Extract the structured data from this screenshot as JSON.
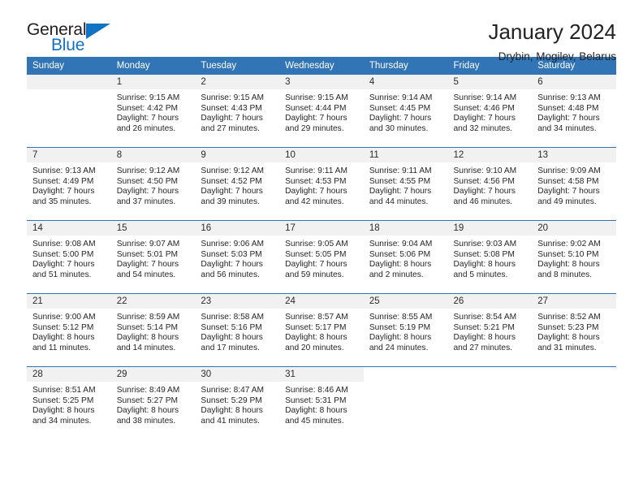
{
  "brand": {
    "name_top": "General",
    "name_bottom": "Blue",
    "accent_color": "#1273c4"
  },
  "header": {
    "title": "January 2024",
    "subtitle": "Drybin, Mogilev, Belarus"
  },
  "theme": {
    "header_blue": "#3175b7",
    "daynum_gray": "#f1f1f1",
    "text": "#262626"
  },
  "calendar": {
    "weekday_headers": [
      "Sunday",
      "Monday",
      "Tuesday",
      "Wednesday",
      "Thursday",
      "Friday",
      "Saturday"
    ],
    "weeks": [
      [
        {
          "day": "",
          "sunrise": "",
          "sunset": "",
          "daylight_1": "",
          "daylight_2": "",
          "empty": true
        },
        {
          "day": "1",
          "sunrise": "Sunrise: 9:15 AM",
          "sunset": "Sunset: 4:42 PM",
          "daylight_1": "Daylight: 7 hours",
          "daylight_2": "and 26 minutes."
        },
        {
          "day": "2",
          "sunrise": "Sunrise: 9:15 AM",
          "sunset": "Sunset: 4:43 PM",
          "daylight_1": "Daylight: 7 hours",
          "daylight_2": "and 27 minutes."
        },
        {
          "day": "3",
          "sunrise": "Sunrise: 9:15 AM",
          "sunset": "Sunset: 4:44 PM",
          "daylight_1": "Daylight: 7 hours",
          "daylight_2": "and 29 minutes."
        },
        {
          "day": "4",
          "sunrise": "Sunrise: 9:14 AM",
          "sunset": "Sunset: 4:45 PM",
          "daylight_1": "Daylight: 7 hours",
          "daylight_2": "and 30 minutes."
        },
        {
          "day": "5",
          "sunrise": "Sunrise: 9:14 AM",
          "sunset": "Sunset: 4:46 PM",
          "daylight_1": "Daylight: 7 hours",
          "daylight_2": "and 32 minutes."
        },
        {
          "day": "6",
          "sunrise": "Sunrise: 9:13 AM",
          "sunset": "Sunset: 4:48 PM",
          "daylight_1": "Daylight: 7 hours",
          "daylight_2": "and 34 minutes."
        }
      ],
      [
        {
          "day": "7",
          "sunrise": "Sunrise: 9:13 AM",
          "sunset": "Sunset: 4:49 PM",
          "daylight_1": "Daylight: 7 hours",
          "daylight_2": "and 35 minutes."
        },
        {
          "day": "8",
          "sunrise": "Sunrise: 9:12 AM",
          "sunset": "Sunset: 4:50 PM",
          "daylight_1": "Daylight: 7 hours",
          "daylight_2": "and 37 minutes."
        },
        {
          "day": "9",
          "sunrise": "Sunrise: 9:12 AM",
          "sunset": "Sunset: 4:52 PM",
          "daylight_1": "Daylight: 7 hours",
          "daylight_2": "and 39 minutes."
        },
        {
          "day": "10",
          "sunrise": "Sunrise: 9:11 AM",
          "sunset": "Sunset: 4:53 PM",
          "daylight_1": "Daylight: 7 hours",
          "daylight_2": "and 42 minutes."
        },
        {
          "day": "11",
          "sunrise": "Sunrise: 9:11 AM",
          "sunset": "Sunset: 4:55 PM",
          "daylight_1": "Daylight: 7 hours",
          "daylight_2": "and 44 minutes."
        },
        {
          "day": "12",
          "sunrise": "Sunrise: 9:10 AM",
          "sunset": "Sunset: 4:56 PM",
          "daylight_1": "Daylight: 7 hours",
          "daylight_2": "and 46 minutes."
        },
        {
          "day": "13",
          "sunrise": "Sunrise: 9:09 AM",
          "sunset": "Sunset: 4:58 PM",
          "daylight_1": "Daylight: 7 hours",
          "daylight_2": "and 49 minutes."
        }
      ],
      [
        {
          "day": "14",
          "sunrise": "Sunrise: 9:08 AM",
          "sunset": "Sunset: 5:00 PM",
          "daylight_1": "Daylight: 7 hours",
          "daylight_2": "and 51 minutes."
        },
        {
          "day": "15",
          "sunrise": "Sunrise: 9:07 AM",
          "sunset": "Sunset: 5:01 PM",
          "daylight_1": "Daylight: 7 hours",
          "daylight_2": "and 54 minutes."
        },
        {
          "day": "16",
          "sunrise": "Sunrise: 9:06 AM",
          "sunset": "Sunset: 5:03 PM",
          "daylight_1": "Daylight: 7 hours",
          "daylight_2": "and 56 minutes."
        },
        {
          "day": "17",
          "sunrise": "Sunrise: 9:05 AM",
          "sunset": "Sunset: 5:05 PM",
          "daylight_1": "Daylight: 7 hours",
          "daylight_2": "and 59 minutes."
        },
        {
          "day": "18",
          "sunrise": "Sunrise: 9:04 AM",
          "sunset": "Sunset: 5:06 PM",
          "daylight_1": "Daylight: 8 hours",
          "daylight_2": "and 2 minutes."
        },
        {
          "day": "19",
          "sunrise": "Sunrise: 9:03 AM",
          "sunset": "Sunset: 5:08 PM",
          "daylight_1": "Daylight: 8 hours",
          "daylight_2": "and 5 minutes."
        },
        {
          "day": "20",
          "sunrise": "Sunrise: 9:02 AM",
          "sunset": "Sunset: 5:10 PM",
          "daylight_1": "Daylight: 8 hours",
          "daylight_2": "and 8 minutes."
        }
      ],
      [
        {
          "day": "21",
          "sunrise": "Sunrise: 9:00 AM",
          "sunset": "Sunset: 5:12 PM",
          "daylight_1": "Daylight: 8 hours",
          "daylight_2": "and 11 minutes."
        },
        {
          "day": "22",
          "sunrise": "Sunrise: 8:59 AM",
          "sunset": "Sunset: 5:14 PM",
          "daylight_1": "Daylight: 8 hours",
          "daylight_2": "and 14 minutes."
        },
        {
          "day": "23",
          "sunrise": "Sunrise: 8:58 AM",
          "sunset": "Sunset: 5:16 PM",
          "daylight_1": "Daylight: 8 hours",
          "daylight_2": "and 17 minutes."
        },
        {
          "day": "24",
          "sunrise": "Sunrise: 8:57 AM",
          "sunset": "Sunset: 5:17 PM",
          "daylight_1": "Daylight: 8 hours",
          "daylight_2": "and 20 minutes."
        },
        {
          "day": "25",
          "sunrise": "Sunrise: 8:55 AM",
          "sunset": "Sunset: 5:19 PM",
          "daylight_1": "Daylight: 8 hours",
          "daylight_2": "and 24 minutes."
        },
        {
          "day": "26",
          "sunrise": "Sunrise: 8:54 AM",
          "sunset": "Sunset: 5:21 PM",
          "daylight_1": "Daylight: 8 hours",
          "daylight_2": "and 27 minutes."
        },
        {
          "day": "27",
          "sunrise": "Sunrise: 8:52 AM",
          "sunset": "Sunset: 5:23 PM",
          "daylight_1": "Daylight: 8 hours",
          "daylight_2": "and 31 minutes."
        }
      ],
      [
        {
          "day": "28",
          "sunrise": "Sunrise: 8:51 AM",
          "sunset": "Sunset: 5:25 PM",
          "daylight_1": "Daylight: 8 hours",
          "daylight_2": "and 34 minutes."
        },
        {
          "day": "29",
          "sunrise": "Sunrise: 8:49 AM",
          "sunset": "Sunset: 5:27 PM",
          "daylight_1": "Daylight: 8 hours",
          "daylight_2": "and 38 minutes."
        },
        {
          "day": "30",
          "sunrise": "Sunrise: 8:47 AM",
          "sunset": "Sunset: 5:29 PM",
          "daylight_1": "Daylight: 8 hours",
          "daylight_2": "and 41 minutes."
        },
        {
          "day": "31",
          "sunrise": "Sunrise: 8:46 AM",
          "sunset": "Sunset: 5:31 PM",
          "daylight_1": "Daylight: 8 hours",
          "daylight_2": "and 45 minutes."
        },
        {
          "day": "",
          "sunrise": "",
          "sunset": "",
          "daylight_1": "",
          "daylight_2": "",
          "blank": true
        },
        {
          "day": "",
          "sunrise": "",
          "sunset": "",
          "daylight_1": "",
          "daylight_2": "",
          "blank": true
        },
        {
          "day": "",
          "sunrise": "",
          "sunset": "",
          "daylight_1": "",
          "daylight_2": "",
          "blank": true
        }
      ]
    ]
  }
}
